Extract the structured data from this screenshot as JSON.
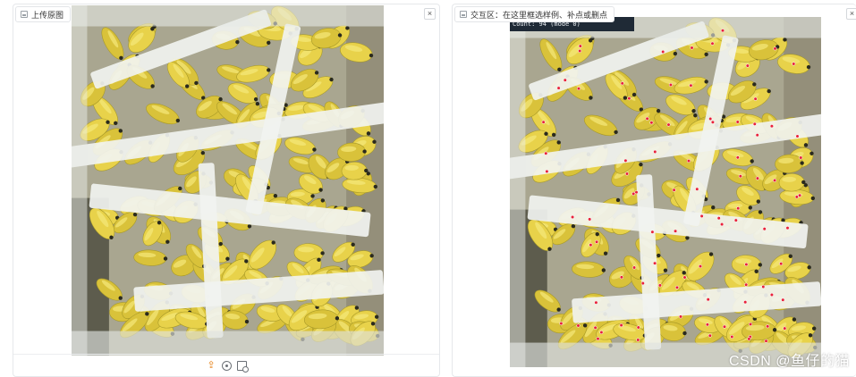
{
  "left_panel": {
    "label": "上传原图",
    "close_glyph": "×",
    "toolbar_icons": [
      "upload-icon",
      "webcam-icon",
      "clipboard-icon"
    ],
    "accent": "#e47f14"
  },
  "right_panel": {
    "label": "交互区：在这里框选样例、补点或删点",
    "close_glyph": "×",
    "count_text": "Count: 94 (mode 0)",
    "marker_color": "#e8223a"
  },
  "watermark": "CSDN @鱼仔的猫"
}
